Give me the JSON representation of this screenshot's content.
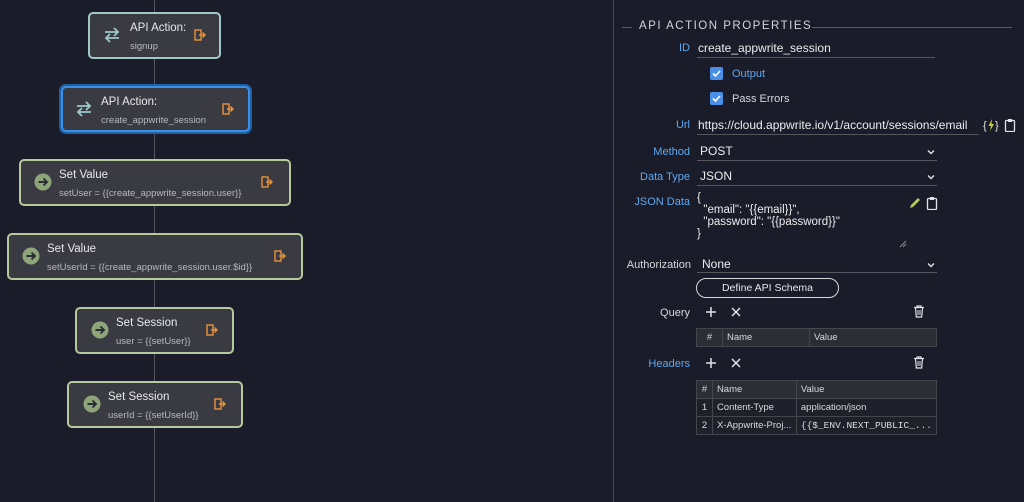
{
  "nodes": [
    {
      "kind": "api",
      "title": "API Action:",
      "subtitle": "signup"
    },
    {
      "kind": "api",
      "title": "API Action:",
      "subtitle": "create_appwrite_session",
      "selected": true
    },
    {
      "kind": "set",
      "title": "Set Value",
      "subtitle": "setUser = {{create_appwrite_session.user}}"
    },
    {
      "kind": "set",
      "title": "Set Value",
      "subtitle": "setUserId = {{create_appwrite_session.user.$id}}"
    },
    {
      "kind": "set",
      "title": "Set Session",
      "subtitle": "user = {{setUser}}"
    },
    {
      "kind": "set",
      "title": "Set Session",
      "subtitle": "userId = {{setUserId}}"
    }
  ],
  "panel": {
    "heading": "API ACTION PROPERTIES",
    "id_label": "ID",
    "id_value": "create_appwrite_session",
    "output_label": "Output",
    "output_checked": true,
    "pass_errors_label": "Pass Errors",
    "pass_errors_checked": true,
    "url_label": "Url",
    "url_value": "https://cloud.appwrite.io/v1/account/sessions/email",
    "method_label": "Method",
    "method_value": "POST",
    "data_type_label": "Data Type",
    "data_type_value": "JSON",
    "json_data_label": "JSON Data",
    "json_data_value": "{\n  \"email\": \"{{email}}\",\n  \"password\": \"{{password}}\"\n}",
    "authorization_label": "Authorization",
    "authorization_value": "None",
    "define_schema_label": "Define API Schema",
    "query_label": "Query",
    "headers_label": "Headers",
    "table_columns": [
      "#",
      "Name",
      "Value"
    ],
    "headers_rows": [
      {
        "num": "1",
        "name": "Content-Type",
        "value": "application/json"
      },
      {
        "num": "2",
        "name": "X-Appwrite-Proj...",
        "value": "{{$_ENV.NEXT_PUBLIC_..."
      }
    ]
  },
  "colors": {
    "accent": "#4a8fe8",
    "label": "#5fa8ee",
    "api_border": "#9fc9c9",
    "set_border": "#b5c99a",
    "exit_icon": "#e8923a"
  },
  "icons": {
    "api_node": "swap-arrows-icon",
    "set_node": "arrow-right-circle-icon",
    "node_exit": "exit-icon",
    "url_params": "curly-bolt-icon",
    "copy": "clipboard-icon",
    "edit": "pencil-icon",
    "add": "plus-icon",
    "remove": "close-icon",
    "delete": "trash-icon",
    "dropdown": "chevron-down-icon"
  }
}
